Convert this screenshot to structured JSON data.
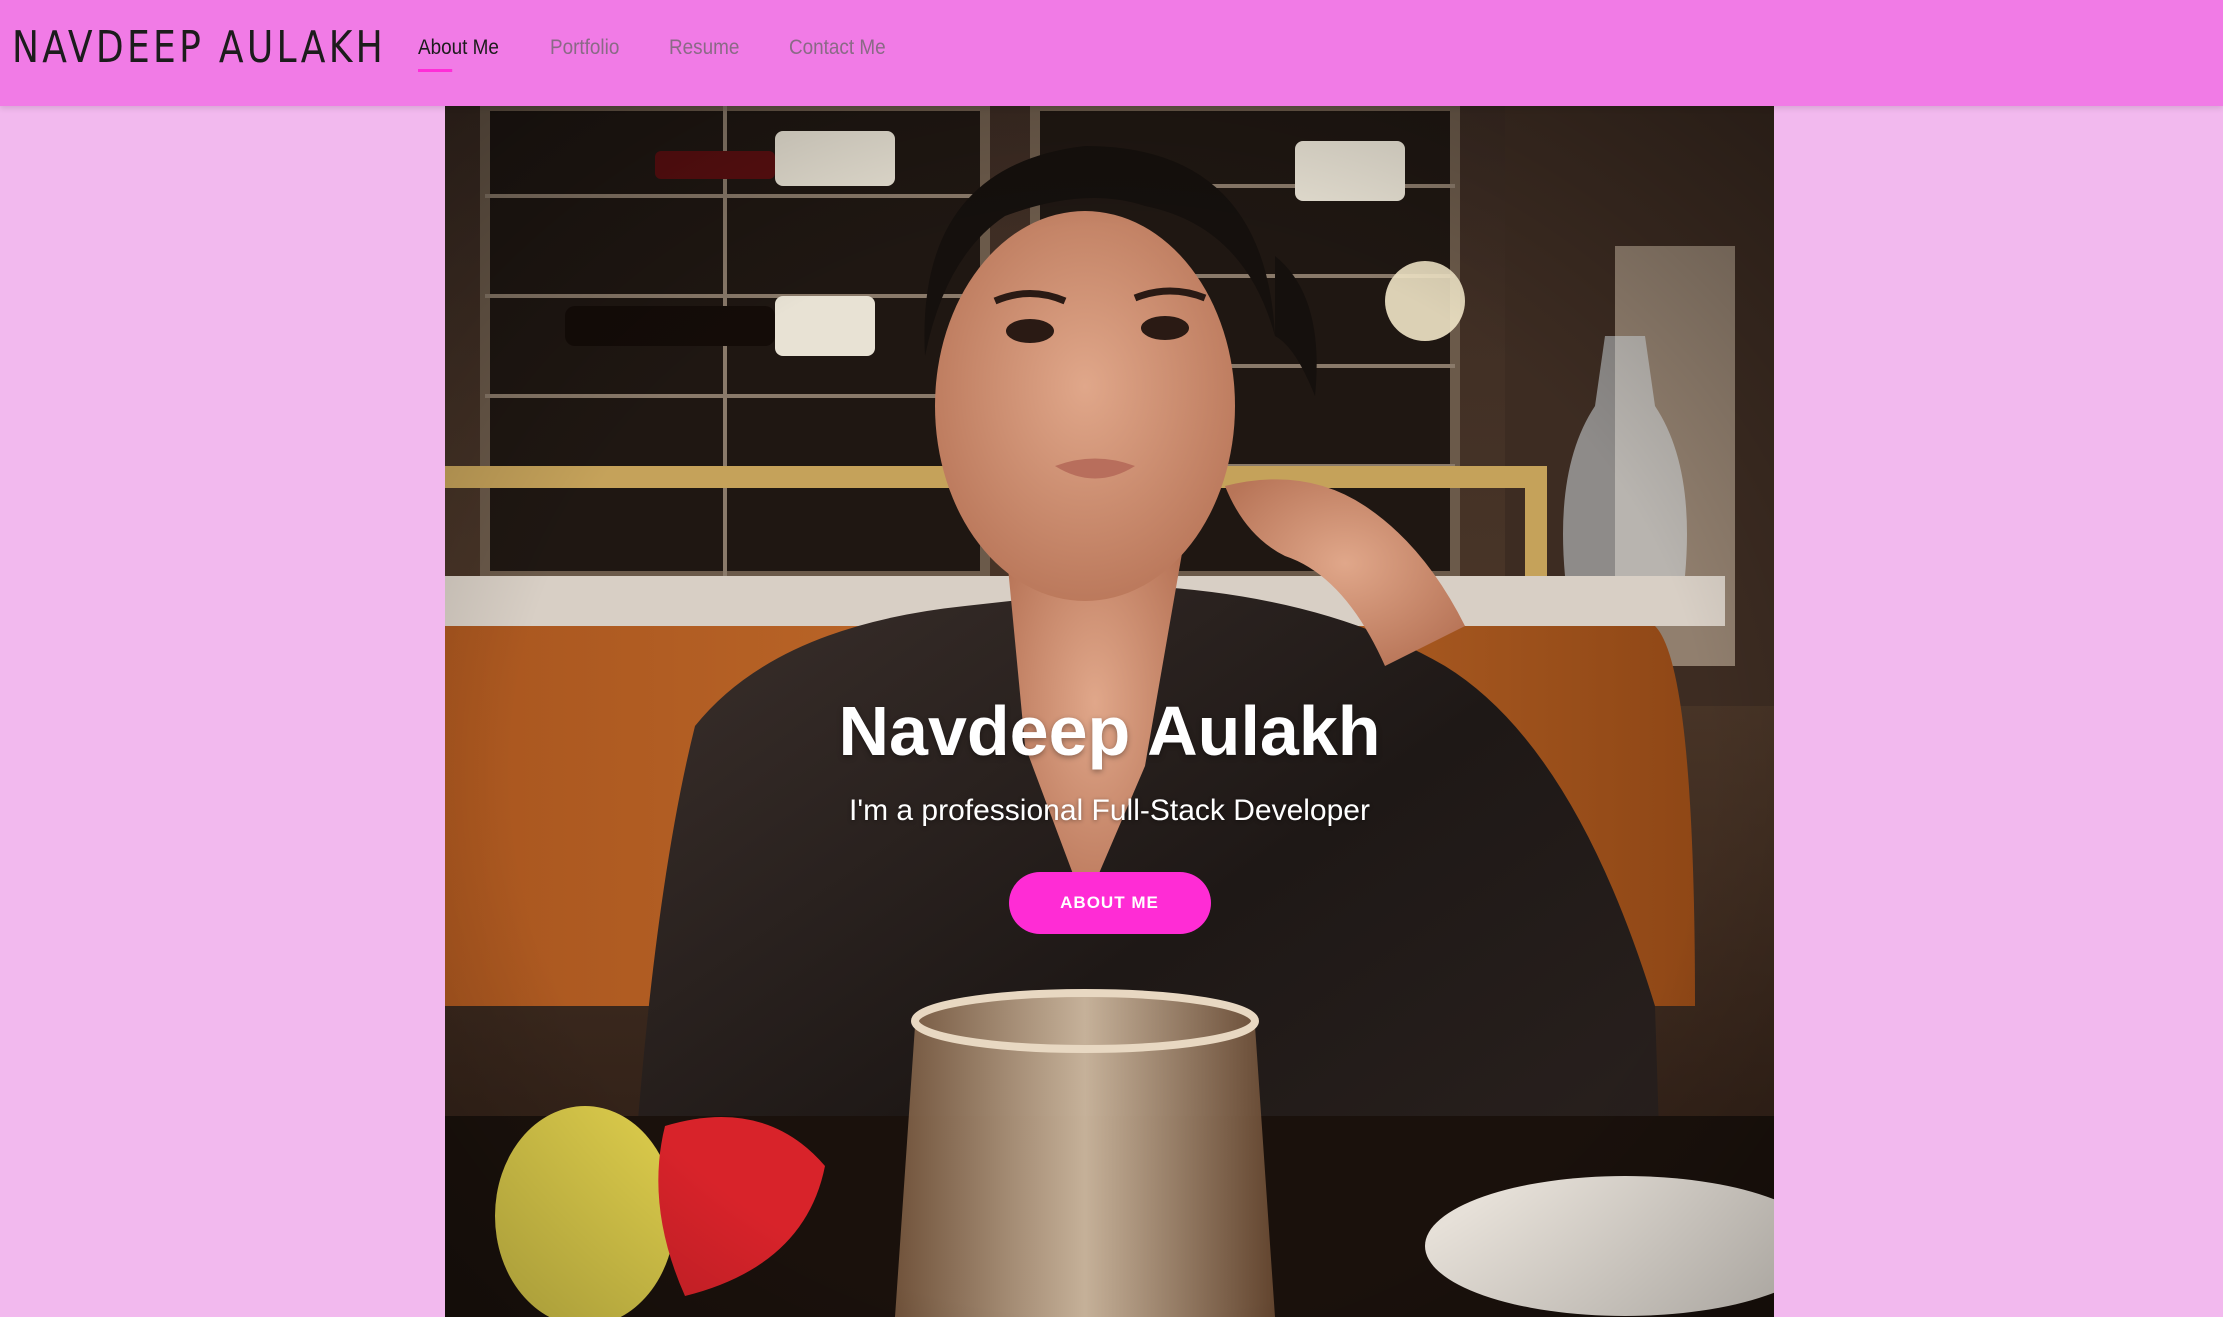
{
  "brand": {
    "name": "NAVDEEP AULAKH"
  },
  "nav": {
    "items": [
      {
        "label": "About Me",
        "active": true
      },
      {
        "label": "Portfolio",
        "active": false
      },
      {
        "label": "Resume",
        "active": false
      },
      {
        "label": "Contact Me",
        "active": false
      }
    ]
  },
  "hero": {
    "title": "Navdeep Aulakh",
    "subtitle": "I'm a professional Full-Stack Developer",
    "button_label": "ABOUT ME",
    "image_alt": "portrait-photo"
  },
  "colors": {
    "page_bg": "#f2b9ee",
    "navbar_bg": "#f17be6",
    "accent": "#ff2cd5",
    "nav_inactive": "#8a6a86",
    "nav_active": "#1c1c1c"
  }
}
